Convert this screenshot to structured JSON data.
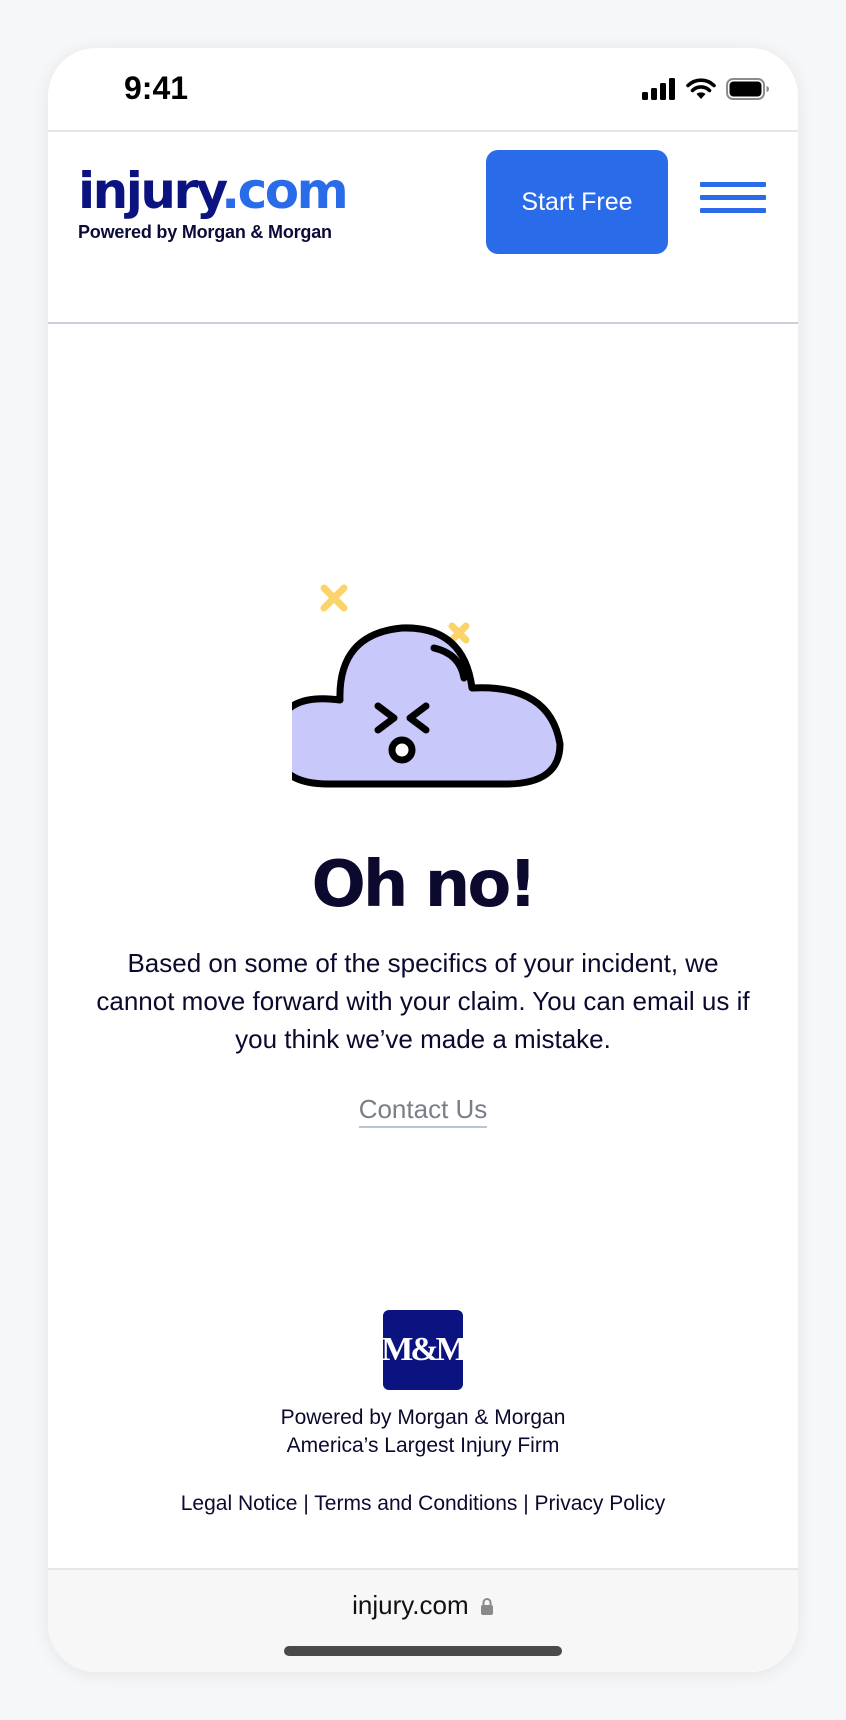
{
  "status_bar": {
    "time": "9:41"
  },
  "header": {
    "logo_main": "injury",
    "logo_tld": ".com",
    "logo_tagline": "Powered by Morgan & Morgan",
    "start_button": "Start Free",
    "menu_icon": "hamburger-menu-icon"
  },
  "colors": {
    "brand_navy": "#0b1380",
    "brand_blue": "#2a6bea",
    "text_dark": "#0b0a2e",
    "cloud_fill": "#c9c8fb",
    "accent_yellow": "#fad46a"
  },
  "main": {
    "illustration": "sad-cloud-icon",
    "title": "Oh no!",
    "message": "Based on some of the specifics of your incident, we cannot move forward with your claim. You can email us if you think we’ve made a mistake.",
    "contact_link": "Contact Us"
  },
  "footer": {
    "logo_text": "M&M",
    "powered_by": "Powered by Morgan & Morgan",
    "tagline": "America’s Largest Injury Firm",
    "links": [
      "Legal Notice",
      "Terms and Conditions",
      "Privacy Policy"
    ],
    "separator": "|"
  },
  "browser": {
    "url": "injury.com",
    "lock_icon": "lock-icon"
  }
}
